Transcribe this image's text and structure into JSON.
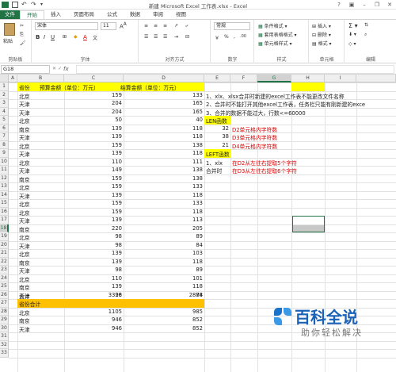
{
  "title": "新建 Microsoft Excel 工作表.xlsx - Excel",
  "tabs": [
    "文件",
    "开始",
    "插入",
    "页面布局",
    "公式",
    "数据",
    "审阅",
    "视图"
  ],
  "active_tab": "开始",
  "ribbon": {
    "clipboard": {
      "paste": "粘贴",
      "label": "剪贴板"
    },
    "font": {
      "name": "宋体",
      "size": "11",
      "label": "字体"
    },
    "align": {
      "label": "对齐方式"
    },
    "number": {
      "format": "常规",
      "label": "数字"
    },
    "styles": {
      "cond": "条件格式",
      "table": "套用表格格式",
      "cell": "单元格样式",
      "label": "样式"
    },
    "cells": {
      "insert": "插入",
      "delete": "删除",
      "format": "格式",
      "label": "单元格"
    },
    "editing": {
      "label": "编辑"
    }
  },
  "namebox": "G18",
  "fx": "fx",
  "columns": [
    "A",
    "B",
    "C",
    "D",
    "E",
    "F",
    "G",
    "H",
    "I"
  ],
  "header": {
    "a": "省份",
    "b": "预算金额（单位：万元）",
    "c": "结算金额（单位：万元）"
  },
  "rows": [
    [
      "北京",
      "159",
      "133"
    ],
    [
      "天津",
      "204",
      "165"
    ],
    [
      "天津",
      "204",
      "165"
    ],
    [
      "北京",
      "50",
      "40"
    ],
    [
      "南京",
      "139",
      "118"
    ],
    [
      "天津",
      "139",
      "118"
    ],
    [
      "北京",
      "159",
      "138"
    ],
    [
      "天津",
      "139",
      "118"
    ],
    [
      "北京",
      "110",
      "111"
    ],
    [
      "天津",
      "149",
      "138"
    ],
    [
      "南京",
      "159",
      "138"
    ],
    [
      "北京",
      "159",
      "133"
    ],
    [
      "天津",
      "139",
      "118"
    ],
    [
      "北京",
      "159",
      "133"
    ],
    [
      "北京",
      "159",
      "118"
    ],
    [
      "天津",
      "139",
      "113"
    ],
    [
      "南京",
      "220",
      "205"
    ],
    [
      "北京",
      "98",
      "89"
    ],
    [
      "天津",
      "98",
      "84"
    ],
    [
      "北京",
      "139",
      "103"
    ],
    [
      "南京",
      "139",
      "118"
    ],
    [
      "天津",
      "98",
      "89"
    ],
    [
      "北京",
      "110",
      "101"
    ],
    [
      "南京",
      "139",
      "118"
    ],
    [
      "天津",
      "98",
      "84"
    ]
  ],
  "total": {
    "label": "合计",
    "b": "3326",
    "c": "2878"
  },
  "province_total": {
    "label": "省份合计"
  },
  "prov_rows": [
    [
      "北京",
      "1105",
      "985"
    ],
    [
      "南京",
      "946",
      "852"
    ],
    [
      "天津",
      "946",
      "852"
    ]
  ],
  "notes": {
    "n1": "1、xlx、xlsx合并时新建的excel工作表不能更改文件名称",
    "n2": "2、合并时不能打开其他excel工作表，任务栏只能有刚新建的exce",
    "n3": "3、合并的数据不能过大，行数<=60000",
    "len_title": "LEN函数",
    "len": [
      [
        "32",
        "D2单元格内字符数"
      ],
      [
        "38",
        "D3单元格内字符数"
      ],
      [
        "21",
        "D4单元格内字符数"
      ]
    ],
    "left_title": "LEFT函数",
    "left": [
      [
        "1、xlx",
        "在D2从左往右提取5个字符"
      ],
      [
        "合并时",
        "在D3从左往右提取6个字符"
      ]
    ]
  },
  "logo": {
    "main": "百科全说",
    "sub": "助你轻松解决"
  }
}
